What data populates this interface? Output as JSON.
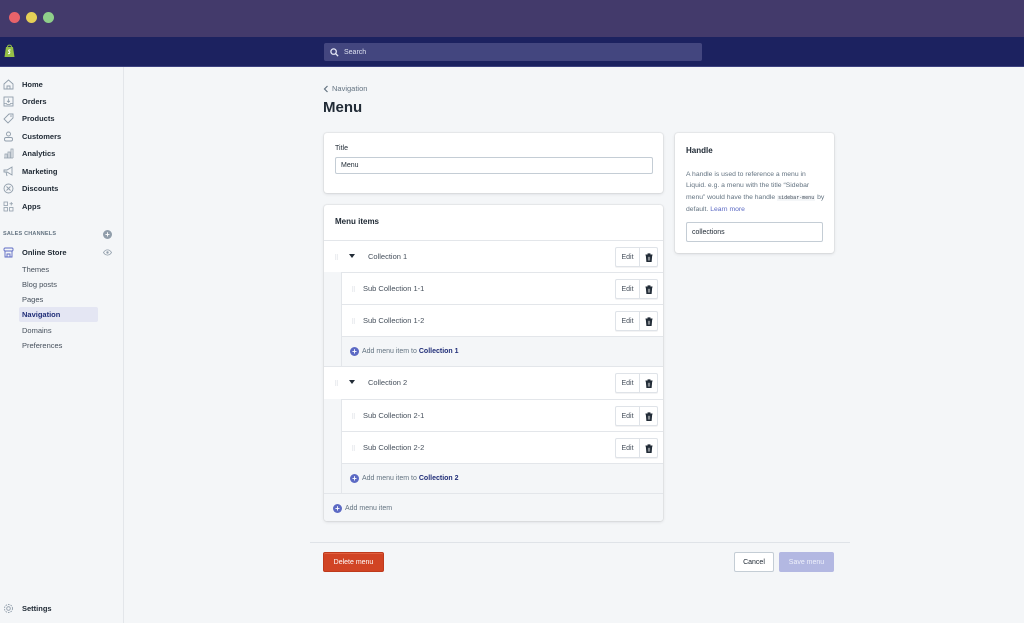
{
  "window": {
    "traffic_lights": [
      "close",
      "minimize",
      "zoom"
    ]
  },
  "topbar": {
    "logo": "shopify-bag-icon",
    "search_placeholder": "Search"
  },
  "sidebar": {
    "items": [
      {
        "label": "Home",
        "icon": "home-icon"
      },
      {
        "label": "Orders",
        "icon": "orders-icon"
      },
      {
        "label": "Products",
        "icon": "tag-icon"
      },
      {
        "label": "Customers",
        "icon": "person-icon"
      },
      {
        "label": "Analytics",
        "icon": "bar-chart-icon"
      },
      {
        "label": "Marketing",
        "icon": "megaphone-icon"
      },
      {
        "label": "Discounts",
        "icon": "discount-icon"
      },
      {
        "label": "Apps",
        "icon": "apps-icon"
      }
    ],
    "sales_channels_label": "SALES CHANNELS",
    "online_store": {
      "label": "Online Store",
      "icon": "store-icon",
      "sub_items": [
        {
          "label": "Themes",
          "active": false
        },
        {
          "label": "Blog posts",
          "active": false
        },
        {
          "label": "Pages",
          "active": false
        },
        {
          "label": "Navigation",
          "active": true
        },
        {
          "label": "Domains",
          "active": false
        },
        {
          "label": "Preferences",
          "active": false
        }
      ]
    },
    "settings_label": "Settings"
  },
  "page": {
    "breadcrumb": "Navigation",
    "title": "Menu"
  },
  "title_card": {
    "label": "Title",
    "value": "Menu"
  },
  "menu_items": {
    "heading": "Menu items",
    "edit_label": "Edit",
    "add_child_prefix": "Add menu item to",
    "add_root_label": "Add menu item",
    "groups": [
      {
        "label": "Collection 1",
        "children": [
          "Sub Collection 1-1",
          "Sub Collection 1-2"
        ]
      },
      {
        "label": "Collection 2",
        "children": [
          "Sub Collection 2-1",
          "Sub Collection 2-2"
        ]
      }
    ]
  },
  "handle_card": {
    "title": "Handle",
    "desc_before": "A handle is used to reference a menu in Liquid. e.g. a menu with the title “Sidebar menu” would have the handle",
    "code": "sidebar-menu",
    "desc_after": "by default.",
    "link": "Learn more",
    "value": "collections"
  },
  "footer": {
    "delete_label": "Delete menu",
    "cancel_label": "Cancel",
    "save_label": "Save menu"
  },
  "colors": {
    "titlebar": "#433a6b",
    "topbar": "#1c2260",
    "accent": "#5c6ac4",
    "danger": "#d14424",
    "save_disabled": "#b3b8e2"
  }
}
